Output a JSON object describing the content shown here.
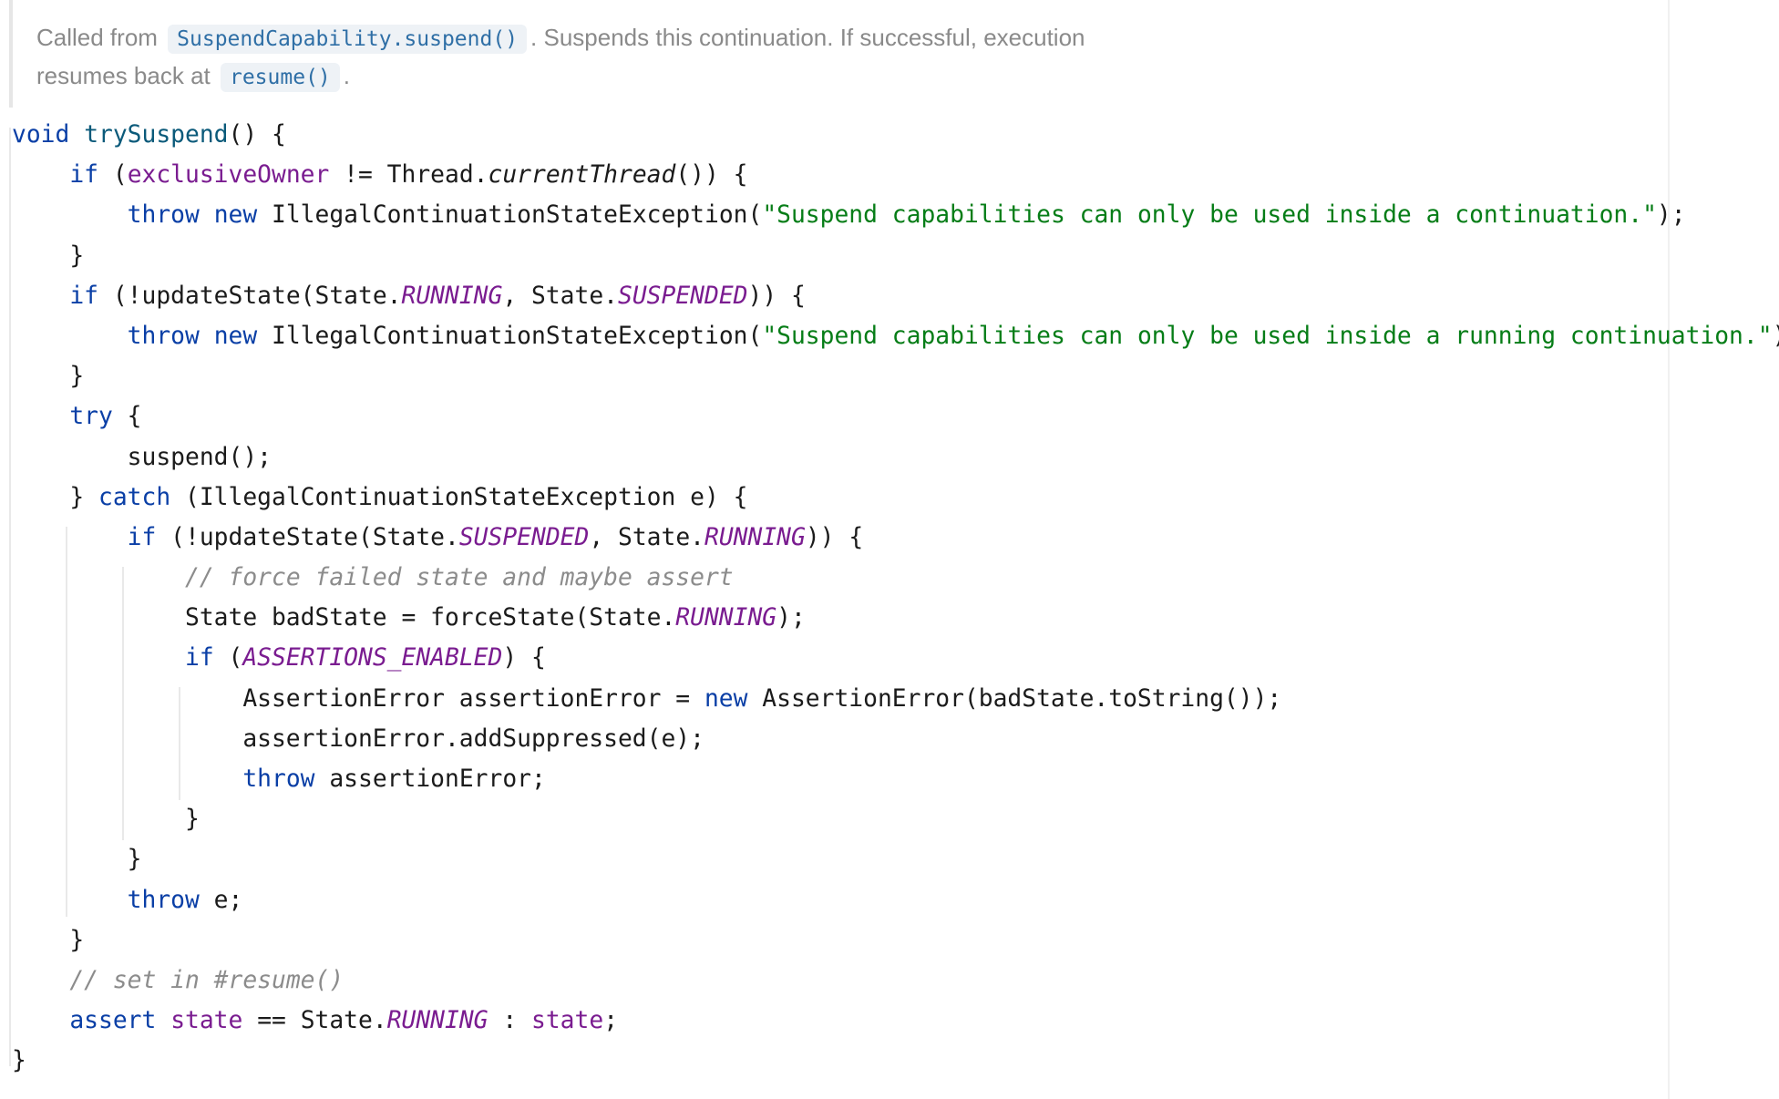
{
  "doc": {
    "line1_prefix": "Called from",
    "line1_chip": "SuspendCapability.suspend()",
    "line1_suffix": ". Suspends this continuation. If successful, execution",
    "line2_prefix": "resumes back at",
    "line2_chip": "resume()",
    "line2_suffix": "."
  },
  "code_lines": [
    [
      {
        "t": "void",
        "c": "kw"
      },
      {
        "t": " "
      },
      {
        "t": "trySuspend",
        "c": "fn"
      },
      {
        "t": "() {"
      }
    ],
    [
      {
        "t": "    "
      },
      {
        "t": "if",
        "c": "kw"
      },
      {
        "t": " ("
      },
      {
        "t": "exclusiveOwner",
        "c": "fld"
      },
      {
        "t": " != Thread."
      },
      {
        "t": "currentThread",
        "c": "it"
      },
      {
        "t": "()) {"
      }
    ],
    [
      {
        "t": "        "
      },
      {
        "t": "throw",
        "c": "kw"
      },
      {
        "t": " "
      },
      {
        "t": "new",
        "c": "kw"
      },
      {
        "t": " IllegalContinuationStateException("
      },
      {
        "t": "\"Suspend capabilities can only be used inside a continuation.\"",
        "c": "str"
      },
      {
        "t": ");"
      }
    ],
    [
      {
        "t": "    }"
      }
    ],
    [
      {
        "t": "    "
      },
      {
        "t": "if",
        "c": "kw"
      },
      {
        "t": " (!updateState(State."
      },
      {
        "t": "RUNNING",
        "c": "const"
      },
      {
        "t": ", State."
      },
      {
        "t": "SUSPENDED",
        "c": "const"
      },
      {
        "t": ")) {"
      }
    ],
    [
      {
        "t": "        "
      },
      {
        "t": "throw",
        "c": "kw"
      },
      {
        "t": " "
      },
      {
        "t": "new",
        "c": "kw"
      },
      {
        "t": " IllegalContinuationStateException("
      },
      {
        "t": "\"Suspend capabilities can only be used inside a running continuation.\"",
        "c": "str"
      },
      {
        "t": ");"
      }
    ],
    [
      {
        "t": "    }"
      }
    ],
    [
      {
        "t": "    "
      },
      {
        "t": "try",
        "c": "kw"
      },
      {
        "t": " {"
      }
    ],
    [
      {
        "t": "        suspend();"
      }
    ],
    [
      {
        "t": "    } "
      },
      {
        "t": "catch",
        "c": "kw"
      },
      {
        "t": " (IllegalContinuationStateException e) {"
      }
    ],
    [
      {
        "t": "        "
      },
      {
        "t": "if",
        "c": "kw"
      },
      {
        "t": " (!updateState(State."
      },
      {
        "t": "SUSPENDED",
        "c": "const"
      },
      {
        "t": ", State."
      },
      {
        "t": "RUNNING",
        "c": "const"
      },
      {
        "t": ")) {"
      }
    ],
    [
      {
        "t": "            "
      },
      {
        "t": "// force failed state and maybe assert",
        "c": "cmt"
      }
    ],
    [
      {
        "t": "            State badState = forceState(State."
      },
      {
        "t": "RUNNING",
        "c": "const"
      },
      {
        "t": ");"
      }
    ],
    [
      {
        "t": "            "
      },
      {
        "t": "if",
        "c": "kw"
      },
      {
        "t": " ("
      },
      {
        "t": "ASSERTIONS_ENABLED",
        "c": "const"
      },
      {
        "t": ") {"
      }
    ],
    [
      {
        "t": "                AssertionError assertionError = "
      },
      {
        "t": "new",
        "c": "kw"
      },
      {
        "t": " AssertionError(badState.toString());"
      }
    ],
    [
      {
        "t": "                assertionError.addSuppressed(e);"
      }
    ],
    [
      {
        "t": "                "
      },
      {
        "t": "throw",
        "c": "kw"
      },
      {
        "t": " assertionError;"
      }
    ],
    [
      {
        "t": "            }"
      }
    ],
    [
      {
        "t": "        }"
      }
    ],
    [
      {
        "t": "        "
      },
      {
        "t": "throw",
        "c": "kw"
      },
      {
        "t": " e;"
      }
    ],
    [
      {
        "t": "    }"
      }
    ],
    [
      {
        "t": "    "
      },
      {
        "t": "// set in #resume()",
        "c": "cmt"
      }
    ],
    [
      {
        "t": "    "
      },
      {
        "t": "assert",
        "c": "kw"
      },
      {
        "t": " "
      },
      {
        "t": "state",
        "c": "fld"
      },
      {
        "t": " == State."
      },
      {
        "t": "RUNNING",
        "c": "const"
      },
      {
        "t": " : "
      },
      {
        "t": "state",
        "c": "fld"
      },
      {
        "t": ";"
      }
    ],
    [
      {
        "t": "}"
      }
    ]
  ]
}
